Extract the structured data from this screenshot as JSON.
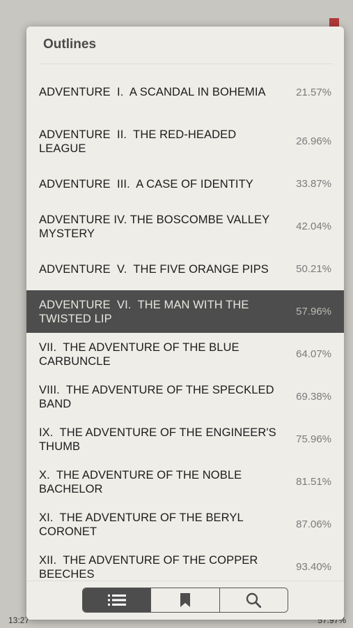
{
  "header": {
    "title": "Outlines"
  },
  "toc": [
    {
      "title": "ADVENTURE  I.  A SCANDAL IN BOHEMIA",
      "percent": "21.57%"
    },
    {
      "title": "ADVENTURE  II.  THE RED-HEADED\nLEAGUE",
      "percent": "26.96%"
    },
    {
      "title": "ADVENTURE  III.  A CASE OF IDENTITY",
      "percent": "33.87%"
    },
    {
      "title": "ADVENTURE IV. THE BOSCOMBE VALLEY\nMYSTERY",
      "percent": "42.04%"
    },
    {
      "title": "ADVENTURE  V.  THE FIVE ORANGE PIPS",
      "percent": "50.21%"
    },
    {
      "title": "ADVENTURE  VI.  THE MAN WITH THE\nTWISTED LIP",
      "percent": "57.96%"
    },
    {
      "title": "VII.  THE ADVENTURE OF THE BLUE\nCARBUNCLE",
      "percent": "64.07%"
    },
    {
      "title": "VIII.  THE ADVENTURE OF THE SPECKLED\nBAND",
      "percent": "69.38%"
    },
    {
      "title": "IX.  THE ADVENTURE OF THE ENGINEER'S\nTHUMB",
      "percent": "75.96%"
    },
    {
      "title": "X.  THE ADVENTURE OF THE NOBLE\nBACHELOR",
      "percent": "81.51%"
    },
    {
      "title": "XI.  THE ADVENTURE OF THE BERYL\nCORONET",
      "percent": "87.06%"
    },
    {
      "title": "XII.  THE ADVENTURE OF THE COPPER\nBEECHES",
      "percent": "93.40%"
    }
  ],
  "active_index": 5,
  "footer": {
    "tabs": [
      {
        "icon": "list-icon",
        "selected": true
      },
      {
        "icon": "bookmark-icon",
        "selected": false
      },
      {
        "icon": "search-icon",
        "selected": false
      }
    ]
  },
  "status": {
    "time": "13:27",
    "percent": "57.97%"
  },
  "colors": {
    "active_row": "#4d4d4d",
    "popover_bg": "#eeede8",
    "ribbon": "#b03a3a"
  }
}
